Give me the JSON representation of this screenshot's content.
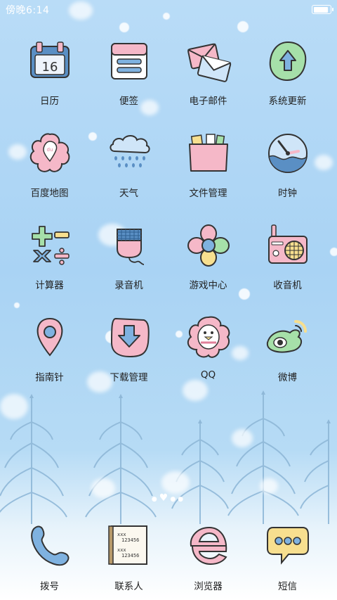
{
  "status_bar": {
    "time": "傍晚6:14",
    "battery_level": 1.0
  },
  "grid_apps": [
    {
      "id": "calendar",
      "label": "日历",
      "icon": "calendar-icon",
      "badge_text": "16"
    },
    {
      "id": "notes",
      "label": "便签",
      "icon": "notes-icon"
    },
    {
      "id": "email",
      "label": "电子邮件",
      "icon": "email-icon"
    },
    {
      "id": "system-update",
      "label": "系统更新",
      "icon": "update-arrow-icon"
    },
    {
      "id": "baidu-maps",
      "label": "百度地图",
      "icon": "map-flower-icon"
    },
    {
      "id": "weather",
      "label": "天气",
      "icon": "rain-cloud-icon"
    },
    {
      "id": "file-manager",
      "label": "文件管理",
      "icon": "folder-icon"
    },
    {
      "id": "clock",
      "label": "时钟",
      "icon": "clock-icon"
    },
    {
      "id": "calculator",
      "label": "计算器",
      "icon": "calculator-icon"
    },
    {
      "id": "recorder",
      "label": "录音机",
      "icon": "microphone-icon"
    },
    {
      "id": "game-center",
      "label": "游戏中心",
      "icon": "flower-icon"
    },
    {
      "id": "radio",
      "label": "收音机",
      "icon": "radio-icon"
    },
    {
      "id": "compass",
      "label": "指南针",
      "icon": "location-pin-icon"
    },
    {
      "id": "download-manager",
      "label": "下载管理",
      "icon": "download-icon"
    },
    {
      "id": "qq",
      "label": "QQ",
      "icon": "penguin-icon"
    },
    {
      "id": "weibo",
      "label": "微博",
      "icon": "weibo-eye-icon"
    }
  ],
  "page_indicator": {
    "pages": 4,
    "current": 1
  },
  "dock_apps": [
    {
      "id": "dialer",
      "label": "拨号",
      "icon": "phone-icon"
    },
    {
      "id": "contacts",
      "label": "联系人",
      "icon": "contacts-card-icon",
      "card_lines": [
        "xxx",
        "123456",
        "xxx",
        "123456"
      ]
    },
    {
      "id": "browser",
      "label": "浏览器",
      "icon": "browser-e-icon"
    },
    {
      "id": "sms",
      "label": "短信",
      "icon": "chat-bubble-icon"
    }
  ],
  "colors": {
    "sky": "#a9d3f4",
    "pink": "#f5b8c8",
    "blue": "#4f8cc9",
    "teal": "#8ec7e8",
    "yellow": "#f7df8f",
    "green": "#a6e0a9",
    "outline": "#333333"
  }
}
